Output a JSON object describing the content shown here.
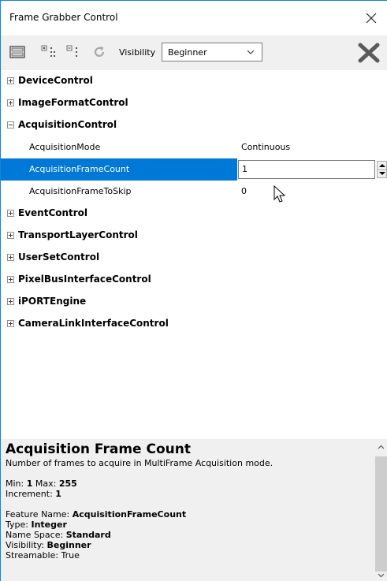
{
  "window": {
    "title": "Frame Grabber Control"
  },
  "toolbar": {
    "visibility_label": "Visibility",
    "visibility_value": "Beginner"
  },
  "tree": {
    "categories_top": [
      {
        "label": "DeviceControl",
        "expanded": false
      },
      {
        "label": "ImageFormatControl",
        "expanded": false
      },
      {
        "label": "AcquisitionControl",
        "expanded": true
      }
    ],
    "properties": [
      {
        "name": "AcquisitionMode",
        "value": "Continuous"
      },
      {
        "name": "AcquisitionFrameCount",
        "value": "1"
      },
      {
        "name": "AcquisitionFrameToSkip",
        "value": "0"
      }
    ],
    "categories_bottom": [
      {
        "label": "EventControl",
        "expanded": false
      },
      {
        "label": "TransportLayerControl",
        "expanded": false
      },
      {
        "label": "UserSetControl",
        "expanded": false
      },
      {
        "label": "PixelBusInterfaceControl",
        "expanded": false
      },
      {
        "label": "iPORTEngine",
        "expanded": false
      },
      {
        "label": "CameraLinkInterfaceControl",
        "expanded": false
      }
    ]
  },
  "description": {
    "title": "Acquisition Frame Count",
    "summary": "Number of frames to acquire in MultiFrame Acquisition mode.",
    "min_label": "Min:",
    "min_value": "1",
    "max_label": "Max:",
    "max_value": "255",
    "increment_label": "Increment:",
    "increment_value": "1",
    "feature_name_label": "Feature Name:",
    "feature_name_value": "AcquisitionFrameCount",
    "type_label": "Type:",
    "type_value": "Integer",
    "namespace_label": "Name Space:",
    "namespace_value": "Standard",
    "visibility_label": "Visibility:",
    "visibility_value": "Beginner",
    "partial_line": "Streamable: True"
  },
  "colors": {
    "selection": "#0078d7",
    "toolbar_bg": "#f0f0f0",
    "window_border": "#1883d7"
  }
}
